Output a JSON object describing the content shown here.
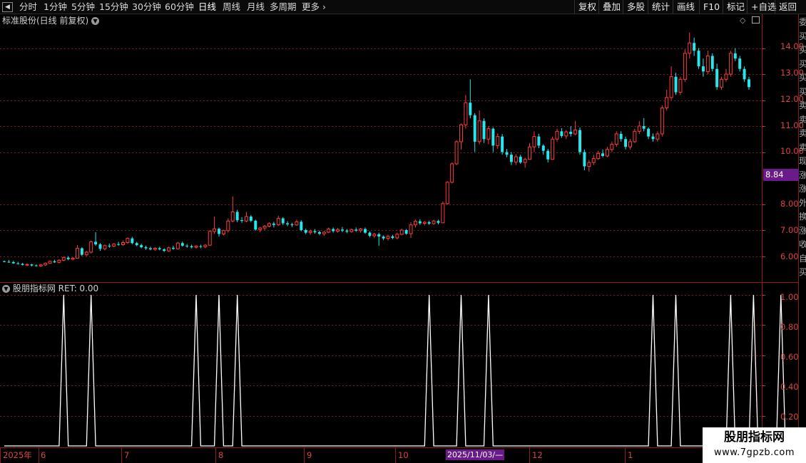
{
  "toolbar": {
    "periods": [
      "分时",
      "1分钟",
      "5分钟",
      "15分钟",
      "30分钟",
      "60分钟",
      "日线",
      "周线",
      "月线",
      "多周期",
      "更多"
    ],
    "active": "日线",
    "right_buttons": [
      "复权",
      "叠加",
      "多股",
      "统计",
      "画线",
      "F10",
      "标记",
      "+自选",
      "返回"
    ]
  },
  "chart_header": {
    "title": "标准股份(日线 前复权)"
  },
  "indicator_header": {
    "title": "股朋指标网 RET: 0.00"
  },
  "price_axis": {
    "labels": [
      "14.00",
      "13.00",
      "12.00",
      "11.00",
      "10.00",
      "8.00",
      "7.00",
      "6.00"
    ],
    "current_price": "8.84"
  },
  "indicator_axis": {
    "labels": [
      "1.00",
      "0.80",
      "0.60",
      "0.40",
      "0.20"
    ]
  },
  "time_axis": {
    "labels": [
      "2025年",
      "6",
      "7",
      "8",
      "9",
      "10",
      "12",
      "1"
    ],
    "crosshair_date": "2025/11/03/—"
  },
  "right_strip": {
    "chars": [
      "委",
      "买",
      "买",
      "买",
      "买",
      "买",
      "卖",
      "卖",
      "卖",
      "卖",
      "现",
      "涨",
      "涨",
      "外",
      "换",
      "涨",
      "收",
      "自",
      "买"
    ]
  },
  "watermark": {
    "title": "股朋指标网",
    "url": "www.7gpzb.com"
  },
  "colors": {
    "up": "#ff3b3b",
    "down": "#26e6ee",
    "grid": "#7a1e1e",
    "signal": "#ffffff",
    "highlight": "#6a1a8a"
  },
  "chart_data": {
    "type": "candlestick",
    "ylim": [
      5.0,
      14.7
    ],
    "ohlc": [
      [
        5.8,
        5.83,
        5.76,
        5.78
      ],
      [
        5.78,
        5.85,
        5.74,
        5.77
      ],
      [
        5.77,
        5.82,
        5.7,
        5.72
      ],
      [
        5.72,
        5.78,
        5.68,
        5.7
      ],
      [
        5.7,
        5.74,
        5.64,
        5.66
      ],
      [
        5.66,
        5.72,
        5.62,
        5.68
      ],
      [
        5.68,
        5.7,
        5.6,
        5.64
      ],
      [
        5.64,
        5.68,
        5.6,
        5.62
      ],
      [
        5.62,
        5.7,
        5.58,
        5.66
      ],
      [
        5.66,
        5.75,
        5.62,
        5.72
      ],
      [
        5.72,
        5.82,
        5.7,
        5.8
      ],
      [
        5.8,
        5.86,
        5.74,
        5.76
      ],
      [
        5.76,
        5.88,
        5.72,
        5.84
      ],
      [
        5.84,
        5.98,
        5.8,
        5.94
      ],
      [
        5.94,
        6.0,
        5.84,
        5.88
      ],
      [
        5.88,
        5.96,
        5.84,
        5.92
      ],
      [
        5.92,
        6.42,
        5.9,
        6.3
      ],
      [
        6.3,
        6.34,
        6.0,
        6.05
      ],
      [
        6.05,
        6.2,
        6.0,
        6.15
      ],
      [
        6.15,
        6.6,
        6.1,
        6.55
      ],
      [
        6.55,
        6.92,
        6.4,
        6.45
      ],
      [
        6.45,
        6.5,
        6.2,
        6.28
      ],
      [
        6.28,
        6.45,
        6.22,
        6.4
      ],
      [
        6.4,
        6.48,
        6.32,
        6.38
      ],
      [
        6.38,
        6.5,
        6.34,
        6.46
      ],
      [
        6.46,
        6.55,
        6.4,
        6.44
      ],
      [
        6.44,
        6.6,
        6.4,
        6.52
      ],
      [
        6.52,
        6.72,
        6.48,
        6.68
      ],
      [
        6.68,
        6.74,
        6.45,
        6.5
      ],
      [
        6.5,
        6.55,
        6.38,
        6.42
      ],
      [
        6.42,
        6.48,
        6.3,
        6.34
      ],
      [
        6.34,
        6.4,
        6.24,
        6.3
      ],
      [
        6.3,
        6.36,
        6.22,
        6.26
      ],
      [
        6.26,
        6.34,
        6.2,
        6.3
      ],
      [
        6.3,
        6.36,
        6.22,
        6.26
      ],
      [
        6.26,
        6.3,
        6.16,
        6.2
      ],
      [
        6.2,
        6.36,
        6.16,
        6.32
      ],
      [
        6.32,
        6.4,
        6.24,
        6.28
      ],
      [
        6.28,
        6.55,
        6.25,
        6.5
      ],
      [
        6.5,
        6.56,
        6.36,
        6.4
      ],
      [
        6.4,
        6.46,
        6.32,
        6.38
      ],
      [
        6.38,
        6.44,
        6.3,
        6.34
      ],
      [
        6.34,
        6.42,
        6.28,
        6.38
      ],
      [
        6.38,
        6.44,
        6.3,
        6.36
      ],
      [
        6.36,
        6.46,
        6.3,
        6.42
      ],
      [
        6.42,
        7.0,
        6.4,
        6.95
      ],
      [
        6.95,
        7.52,
        6.85,
        7.05
      ],
      [
        7.05,
        7.1,
        6.75,
        6.85
      ],
      [
        6.85,
        7.02,
        6.8,
        6.98
      ],
      [
        6.98,
        7.45,
        6.9,
        7.35
      ],
      [
        7.35,
        8.3,
        7.3,
        7.7
      ],
      [
        7.7,
        7.78,
        7.3,
        7.38
      ],
      [
        7.38,
        7.5,
        7.28,
        7.35
      ],
      [
        7.35,
        7.7,
        7.3,
        7.52
      ],
      [
        7.52,
        7.58,
        7.3,
        7.36
      ],
      [
        7.36,
        7.4,
        6.98,
        7.02
      ],
      [
        7.02,
        7.12,
        6.92,
        7.08
      ],
      [
        7.08,
        7.2,
        7.0,
        7.15
      ],
      [
        7.15,
        7.3,
        7.1,
        7.25
      ],
      [
        7.25,
        7.32,
        7.1,
        7.2
      ],
      [
        7.2,
        7.55,
        7.16,
        7.45
      ],
      [
        7.45,
        7.5,
        7.2,
        7.26
      ],
      [
        7.26,
        7.34,
        7.15,
        7.22
      ],
      [
        7.22,
        7.28,
        7.12,
        7.2
      ],
      [
        7.2,
        7.4,
        7.16,
        7.32
      ],
      [
        7.32,
        7.38,
        6.95,
        7.0
      ],
      [
        7.0,
        7.06,
        6.84,
        6.9
      ],
      [
        6.9,
        7.02,
        6.82,
        6.96
      ],
      [
        6.96,
        7.04,
        6.86,
        6.92
      ],
      [
        6.92,
        6.98,
        6.8,
        6.86
      ],
      [
        6.86,
        6.96,
        6.78,
        6.92
      ],
      [
        6.92,
        7.1,
        6.88,
        7.04
      ],
      [
        7.04,
        7.1,
        6.9,
        6.96
      ],
      [
        6.96,
        7.08,
        6.9,
        7.02
      ],
      [
        7.02,
        7.12,
        6.92,
        6.98
      ],
      [
        6.98,
        7.04,
        6.88,
        6.94
      ],
      [
        6.94,
        7.06,
        6.9,
        7.02
      ],
      [
        7.02,
        7.1,
        6.94,
        6.98
      ],
      [
        6.98,
        7.08,
        6.9,
        7.04
      ],
      [
        7.04,
        7.1,
        6.86,
        6.9
      ],
      [
        6.9,
        6.95,
        6.72,
        6.78
      ],
      [
        6.78,
        6.9,
        6.7,
        6.84
      ],
      [
        6.84,
        6.9,
        6.4,
        6.75
      ],
      [
        6.75,
        6.8,
        6.62,
        6.68
      ],
      [
        6.68,
        6.82,
        6.6,
        6.76
      ],
      [
        6.76,
        6.82,
        6.65,
        6.7
      ],
      [
        6.7,
        6.9,
        6.64,
        6.84
      ],
      [
        6.84,
        7.05,
        6.8,
        7.0
      ],
      [
        7.0,
        7.04,
        6.82,
        6.86
      ],
      [
        6.86,
        7.3,
        6.7,
        7.2
      ],
      [
        7.2,
        7.4,
        7.1,
        7.34
      ],
      [
        7.34,
        7.42,
        7.2,
        7.26
      ],
      [
        7.26,
        7.35,
        7.18,
        7.3
      ],
      [
        7.3,
        7.36,
        7.2,
        7.25
      ],
      [
        7.25,
        7.4,
        7.2,
        7.35
      ],
      [
        7.35,
        7.4,
        7.22,
        7.28
      ],
      [
        7.28,
        8.1,
        7.92,
        8.02
      ],
      [
        8.02,
        8.88,
        7.98,
        8.84
      ],
      [
        8.84,
        9.6,
        8.8,
        9.55
      ],
      [
        9.55,
        10.45,
        9.5,
        10.4
      ],
      [
        10.4,
        11.1,
        10.1,
        11.05
      ],
      [
        11.05,
        12.2,
        10.9,
        11.9
      ],
      [
        11.9,
        12.8,
        11.3,
        11.42
      ],
      [
        11.42,
        11.5,
        10.0,
        10.4
      ],
      [
        10.4,
        11.6,
        10.3,
        11.2
      ],
      [
        11.2,
        11.3,
        10.35,
        10.5
      ],
      [
        10.5,
        11.0,
        10.3,
        10.9
      ],
      [
        10.9,
        10.95,
        10.0,
        10.25
      ],
      [
        10.25,
        10.72,
        10.12,
        10.6
      ],
      [
        10.6,
        10.7,
        9.9,
        10.0
      ],
      [
        10.0,
        10.12,
        9.8,
        9.9
      ],
      [
        9.9,
        10.0,
        9.5,
        9.62
      ],
      [
        9.62,
        9.92,
        9.5,
        9.82
      ],
      [
        9.82,
        9.9,
        9.55,
        9.6
      ],
      [
        9.6,
        9.78,
        9.4,
        9.72
      ],
      [
        9.72,
        10.35,
        9.7,
        10.2
      ],
      [
        10.2,
        10.8,
        10.0,
        10.6
      ],
      [
        10.6,
        10.7,
        10.15,
        10.25
      ],
      [
        10.25,
        10.3,
        9.9,
        10.05
      ],
      [
        10.05,
        10.12,
        9.6,
        9.72
      ],
      [
        9.72,
        10.6,
        9.7,
        10.5
      ],
      [
        10.5,
        10.9,
        10.4,
        10.8
      ],
      [
        10.8,
        10.92,
        10.55,
        10.62
      ],
      [
        10.62,
        10.85,
        10.5,
        10.78
      ],
      [
        10.78,
        11.0,
        10.6,
        10.7
      ],
      [
        10.7,
        11.2,
        10.65,
        10.85
      ],
      [
        10.85,
        10.95,
        9.9,
        10.0
      ],
      [
        10.0,
        10.1,
        9.3,
        9.45
      ],
      [
        9.45,
        9.7,
        9.25,
        9.6
      ],
      [
        9.6,
        9.9,
        9.5,
        9.75
      ],
      [
        9.75,
        10.05,
        9.7,
        9.95
      ],
      [
        9.95,
        10.1,
        9.8,
        9.85
      ],
      [
        9.85,
        10.2,
        9.8,
        10.1
      ],
      [
        10.1,
        10.4,
        10.0,
        10.3
      ],
      [
        10.3,
        10.8,
        10.2,
        10.7
      ],
      [
        10.7,
        10.8,
        10.4,
        10.5
      ],
      [
        10.5,
        10.6,
        10.1,
        10.2
      ],
      [
        10.2,
        10.5,
        10.1,
        10.4
      ],
      [
        10.4,
        10.9,
        10.35,
        10.8
      ],
      [
        10.8,
        11.2,
        10.7,
        11.0
      ],
      [
        11.0,
        11.3,
        10.8,
        10.9
      ],
      [
        10.9,
        10.95,
        10.5,
        10.6
      ],
      [
        10.6,
        10.72,
        10.4,
        10.5
      ],
      [
        10.5,
        10.8,
        10.4,
        10.7
      ],
      [
        10.7,
        11.8,
        10.6,
        11.7
      ],
      [
        11.7,
        12.4,
        11.6,
        12.1
      ],
      [
        12.1,
        13.3,
        12.0,
        12.9
      ],
      [
        12.9,
        13.05,
        12.2,
        12.3
      ],
      [
        12.3,
        12.9,
        12.2,
        12.8
      ],
      [
        12.8,
        13.95,
        12.7,
        13.8
      ],
      [
        13.8,
        14.6,
        13.6,
        14.2
      ],
      [
        14.2,
        14.4,
        13.7,
        13.9
      ],
      [
        13.9,
        14.0,
        13.2,
        13.3
      ],
      [
        13.3,
        13.6,
        12.9,
        13.1
      ],
      [
        13.1,
        13.9,
        13.0,
        13.7
      ],
      [
        13.7,
        13.8,
        13.1,
        13.2
      ],
      [
        13.2,
        13.4,
        12.4,
        12.5
      ],
      [
        12.5,
        12.9,
        12.4,
        12.8
      ],
      [
        12.8,
        13.2,
        12.7,
        13.0
      ],
      [
        13.0,
        13.9,
        12.9,
        13.8
      ],
      [
        13.8,
        14.0,
        13.5,
        13.6
      ],
      [
        13.6,
        13.7,
        13.1,
        13.2
      ],
      [
        13.2,
        13.3,
        12.7,
        12.8
      ],
      [
        12.8,
        12.9,
        12.4,
        12.5
      ]
    ],
    "signal": [
      0,
      0,
      0,
      0,
      0,
      0,
      0,
      0,
      0,
      0,
      0,
      0,
      0,
      1,
      0,
      0,
      0,
      0,
      0,
      1,
      0,
      0,
      0,
      0,
      0,
      0,
      0,
      0,
      0,
      0,
      0,
      0,
      0,
      0,
      0,
      0,
      0,
      0,
      0,
      0,
      0,
      0,
      1,
      0,
      0,
      0,
      0,
      1,
      0,
      0,
      0,
      1,
      0,
      0,
      0,
      0,
      0,
      0,
      0,
      0,
      0,
      0,
      0,
      0,
      0,
      0,
      0,
      0,
      0,
      0,
      0,
      0,
      0,
      0,
      0,
      0,
      0,
      0,
      0,
      0,
      0,
      0,
      0,
      0,
      0,
      0,
      0,
      0,
      0,
      0,
      0,
      0,
      0,
      1,
      0,
      0,
      0,
      0,
      0,
      0,
      1,
      0,
      0,
      0,
      0,
      0,
      1,
      0,
      0,
      0,
      0,
      0,
      0,
      0,
      0,
      0,
      0,
      0,
      0,
      0,
      0,
      0,
      0,
      0,
      0,
      0,
      0,
      0,
      0,
      0,
      0,
      0,
      0,
      0,
      0,
      0,
      0,
      0,
      0,
      0,
      0,
      0,
      1,
      0,
      0,
      0,
      0,
      1,
      0,
      0,
      0,
      0,
      0,
      0,
      0,
      0,
      0,
      0,
      0,
      1,
      0,
      0,
      0,
      0,
      1,
      0,
      0,
      0,
      0,
      0,
      1,
      0,
      0,
      0,
      0,
      0,
      0,
      0,
      0,
      0,
      0,
      0,
      0,
      0
    ]
  }
}
